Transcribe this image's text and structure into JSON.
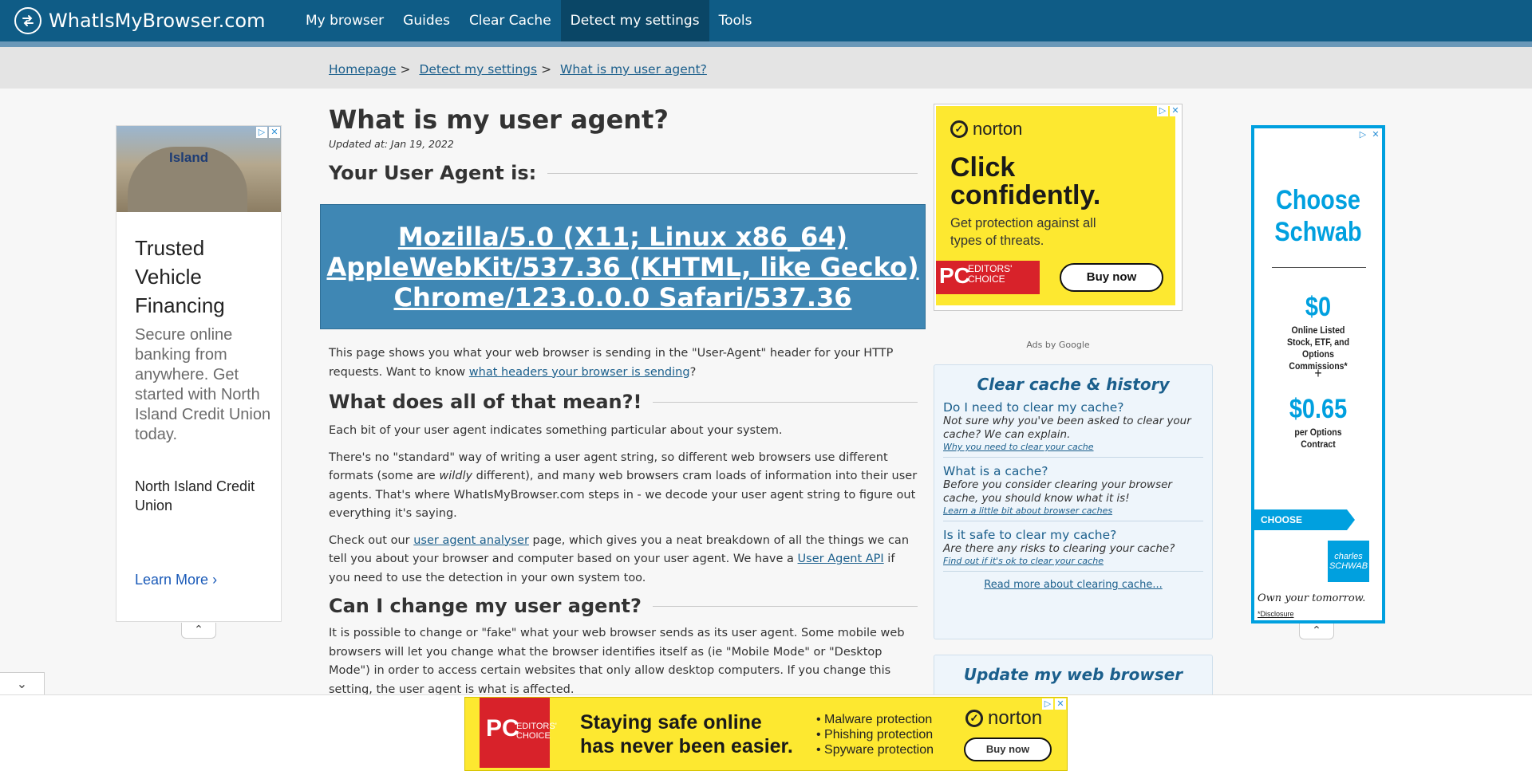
{
  "site": {
    "name": "WhatIsMyBrowser.com"
  },
  "nav": {
    "items": [
      {
        "label": "My browser"
      },
      {
        "label": "Guides"
      },
      {
        "label": "Clear Cache"
      },
      {
        "label": "Detect my settings"
      },
      {
        "label": "Tools"
      }
    ],
    "active_index": 3
  },
  "breadcrumb": {
    "items": [
      "Homepage",
      "Detect my settings",
      "What is my user agent?"
    ],
    "separator": ">"
  },
  "main": {
    "title": "What is my user agent?",
    "updated": "Updated at: Jan 19, 2022",
    "ua_heading": "Your User Agent is:",
    "ua_string_lines": [
      "Mozilla/5.0 (X11; Linux x86_64)",
      "AppleWebKit/537.36 (KHTML, like Gecko)",
      "Chrome/123.0.0.0 Safari/537.36"
    ],
    "intro": {
      "before": "This page shows you what your web browser is sending in the \"User-Agent\" header for your HTTP requests. Want to know ",
      "link": "what headers your browser is sending",
      "after": "?"
    },
    "section1_heading": "What does all of that mean?!",
    "section1_p1": "Each bit of your user agent indicates something particular about your system.",
    "section1_p2": {
      "before": "There's no \"standard\" way of writing a user agent string, so different web browsers use different formats (some are ",
      "em": "wildly",
      "after": " different), and many web browsers cram loads of information into their user agents. That's where WhatIsMyBrowser.com steps in - we decode your user agent string to figure out everything it's saying."
    },
    "section1_p3": {
      "before": "Check out our ",
      "link1": "user agent analyser",
      "middle": " page, which gives you a neat breakdown of all the things we can tell you about your browser and computer based on your user agent. We have a ",
      "link2": "User Agent API",
      "after": " if you need to use the detection in your own system too."
    },
    "section2_heading": "Can I change my user agent?",
    "section2_p1": "It is possible to change or \"fake\" what your web browser sends as its user agent. Some mobile web browsers will let you change what the browser identifies itself as (ie \"Mobile Mode\" or \"Desktop Mode\") in order to access certain websites that only allow desktop computers. If you change this setting, the user agent is what is affected."
  },
  "ads": {
    "left": {
      "image_sign": "Island",
      "headline": "Trusted Vehicle Financing",
      "description": "Secure online banking from anywhere. Get started with North Island Credit Union today.",
      "advertiser": "North Island Credit Union",
      "cta": "Learn More"
    },
    "norton_top": {
      "brand": "norton",
      "headline": "Click confidently.",
      "subtext": "Get protection against all types of threats.",
      "badge_pc": "PC",
      "badge_text": "EDITORS' CHOICE",
      "cta": "Buy now"
    },
    "ads_by": "Ads by Google",
    "right": {
      "title": "Choose Schwab",
      "price1": "$0",
      "price1_desc": "Online Listed Stock, ETF, and Options Commissions*",
      "plus": "+",
      "price2": "$0.65",
      "price2_desc": "per Options Contract",
      "cta": "CHOOSE SCHWAB",
      "logo": "charles SCHWAB",
      "tagline": "Own your tomorrow.",
      "disclosure": "*Disclosure"
    },
    "bottom": {
      "badge_pc": "PC",
      "badge_text": "EDITORS' CHOICE",
      "headline_1": "Staying safe online",
      "headline_2": "has never been easier.",
      "bullets": [
        "Malware protection",
        "Phishing protection",
        "Spyware protection"
      ],
      "brand": "norton",
      "cta": "Buy now"
    }
  },
  "sidebar": {
    "cache_widget": {
      "title": "Clear cache & history",
      "items": [
        {
          "question": "Do I need to clear my cache?",
          "answer": "Not sure why you've been asked to clear your cache? We can explain.",
          "link": "Why you need to clear your cache"
        },
        {
          "question": "What is a cache?",
          "answer": "Before you consider clearing your browser cache, you should know what it is!",
          "link": "Learn a little bit about browser caches"
        },
        {
          "question": "Is it safe to clear my cache?",
          "answer": "Are there any risks to clearing your cache?",
          "link": "Find out if it's ok to clear your cache"
        }
      ],
      "more": "Read more about clearing cache..."
    },
    "update_widget": {
      "title": "Update my web browser"
    }
  },
  "colors": {
    "header": "#0f5c86",
    "ua_box": "#3f87b4",
    "link": "#1b5f8c",
    "norton_yellow": "#fde830",
    "schwab_blue": "#00a0df"
  }
}
